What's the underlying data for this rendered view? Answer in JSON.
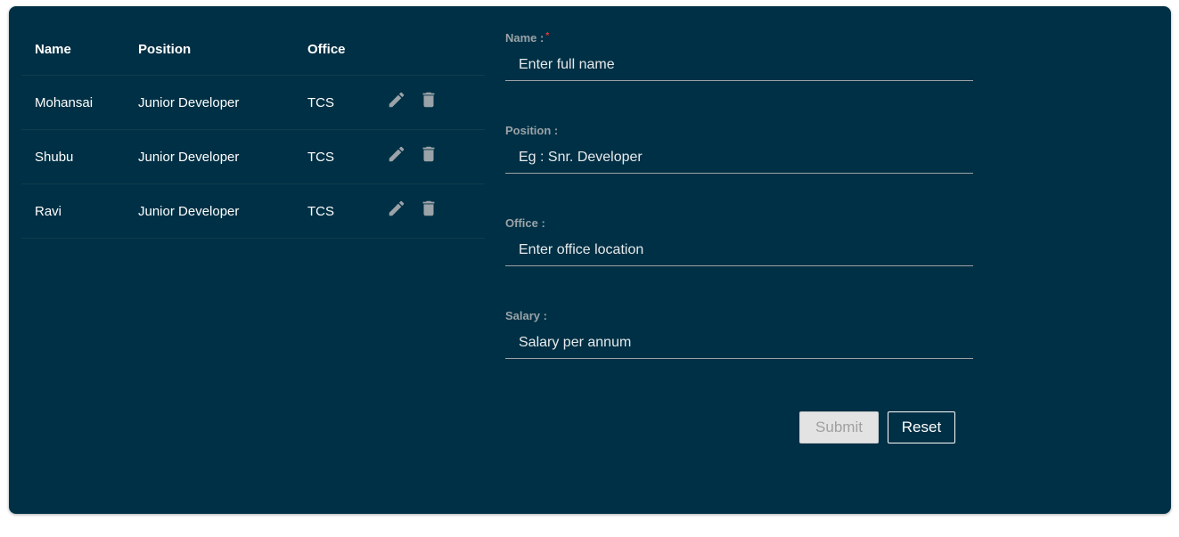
{
  "table": {
    "headers": {
      "name": "Name",
      "position": "Position",
      "office": "Office"
    },
    "rows": [
      {
        "name": "Mohansai",
        "position": "Junior Developer",
        "office": "TCS"
      },
      {
        "name": "Shubu",
        "position": "Junior Developer",
        "office": "TCS"
      },
      {
        "name": "Ravi",
        "position": "Junior Developer",
        "office": "TCS"
      }
    ],
    "row_actions": [
      "pencil-icon",
      "trash-icon"
    ]
  },
  "form": {
    "name": {
      "label": "Name :",
      "required_mark": "*",
      "placeholder": "Enter full name",
      "value": ""
    },
    "position": {
      "label": "Position :",
      "placeholder": "Eg : Snr. Developer",
      "value": ""
    },
    "office": {
      "label": "Office :",
      "placeholder": "Enter office location",
      "value": ""
    },
    "salary": {
      "label": "Salary :",
      "placeholder": "Salary per annum",
      "value": ""
    },
    "submit_label": "Submit",
    "reset_label": "Reset"
  },
  "colors": {
    "card_background": "#003045",
    "icon": "#9aa3a8",
    "required": "#e53935",
    "submit_disabled_bg": "#e3e3e3"
  }
}
